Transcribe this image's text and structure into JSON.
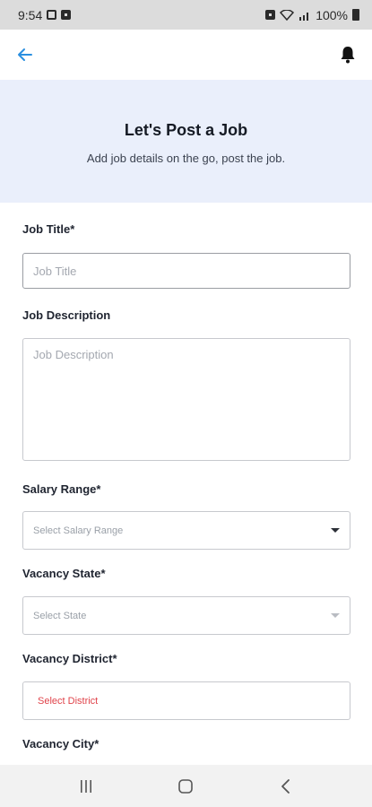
{
  "status_bar": {
    "time": "9:54",
    "battery": "100%"
  },
  "hero": {
    "title": "Let's Post a Job",
    "subtitle": "Add job details on the go, post the job."
  },
  "form": {
    "job_title": {
      "label": "Job Title*",
      "placeholder": "Job Title"
    },
    "job_description": {
      "label": "Job Description",
      "placeholder": "Job Description"
    },
    "salary_range": {
      "label": "Salary Range*",
      "value": "Select Salary Range"
    },
    "vacancy_state": {
      "label": "Vacancy State*",
      "value": "Select State"
    },
    "vacancy_district": {
      "label": "Vacancy District*",
      "value": "Select District"
    },
    "vacancy_city": {
      "label": "Vacancy City*"
    }
  },
  "colors": {
    "accent": "#2a8fe0",
    "hero_bg": "#eaeffb",
    "error_text": "#e0434a"
  },
  "icons": {
    "back": "arrow-left-icon",
    "notifications": "bell-icon"
  }
}
